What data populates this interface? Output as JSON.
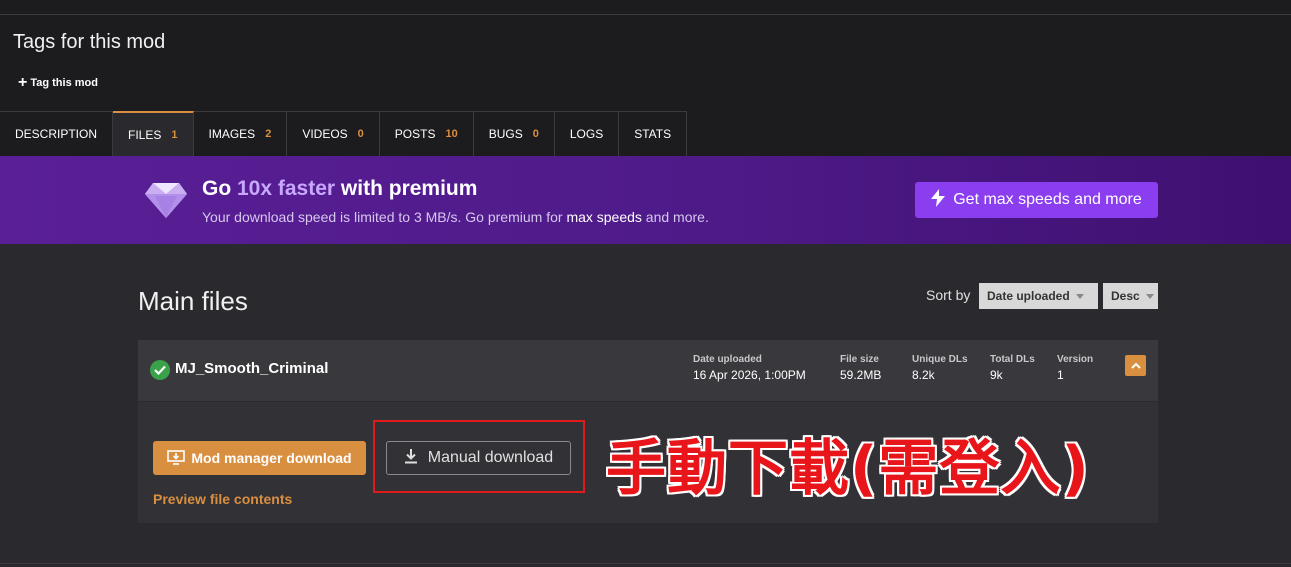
{
  "tags": {
    "title": "Tags for this mod",
    "tag_button": "Tag this mod"
  },
  "tabs": [
    {
      "label": "DESCRIPTION",
      "count": ""
    },
    {
      "label": "FILES",
      "count": "1"
    },
    {
      "label": "IMAGES",
      "count": "2"
    },
    {
      "label": "VIDEOS",
      "count": "0"
    },
    {
      "label": "POSTS",
      "count": "10"
    },
    {
      "label": "BUGS",
      "count": "0"
    },
    {
      "label": "LOGS",
      "count": ""
    },
    {
      "label": "STATS",
      "count": ""
    }
  ],
  "premium": {
    "title_pre": "Go ",
    "title_highlight": "10x faster",
    "title_post": " with premium",
    "sub_pre": "Your download speed is limited to 3 MB/s. Go premium for ",
    "sub_bold": "max speeds",
    "sub_post": " and more.",
    "button": "Get max speeds and more"
  },
  "main": {
    "title": "Main files",
    "sort_label": "Sort by",
    "sort_field": "Date uploaded",
    "sort_order": "Desc"
  },
  "file": {
    "name": "MJ_Smooth_Criminal",
    "meta": [
      {
        "label": "Date uploaded",
        "value": "16 Apr 2026, 1:00PM"
      },
      {
        "label": "File size",
        "value": "59.2MB"
      },
      {
        "label": "Unique DLs",
        "value": "8.2k"
      },
      {
        "label": "Total DLs",
        "value": "9k"
      },
      {
        "label": "Version",
        "value": "1"
      }
    ],
    "mod_manager_button": "Mod manager download",
    "manual_button": "Manual download",
    "preview_link": "Preview file contents"
  },
  "annotation": "手動下載(需登入)",
  "colors": {
    "accent": "#d98f40",
    "premium_button": "#8b3df0",
    "highlight": "#e01b1b"
  }
}
